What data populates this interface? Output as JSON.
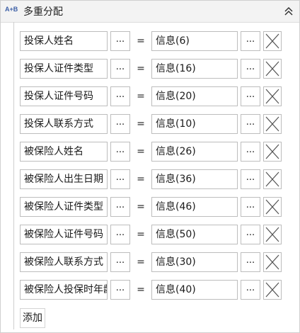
{
  "header": {
    "icon_text": "A+B",
    "title": "多重分配"
  },
  "rows": [
    {
      "left": "投保人姓名",
      "right": "信息(6)"
    },
    {
      "left": "投保人证件类型",
      "right": "信息(16)"
    },
    {
      "left": "投保人证件号码",
      "right": "信息(20)"
    },
    {
      "left": "投保人联系方式",
      "right": "信息(10)"
    },
    {
      "left": "被保险人姓名",
      "right": "信息(26)"
    },
    {
      "left": "被保险人出生日期",
      "right": "信息(36)"
    },
    {
      "left": "被保险人证件类型",
      "right": "信息(46)"
    },
    {
      "left": "被保险人证件号码",
      "right": "信息(50)"
    },
    {
      "left": "被保险人联系方式",
      "right": "信息(30)"
    },
    {
      "left": "被保险人投保时年龄",
      "right": "信息(40)"
    }
  ],
  "labels": {
    "dots": "...",
    "equals": "=",
    "add": "添加"
  },
  "icons": {
    "header": "assign-icon",
    "collapse": "double-chevron-up-icon",
    "delete": "close-icon"
  }
}
